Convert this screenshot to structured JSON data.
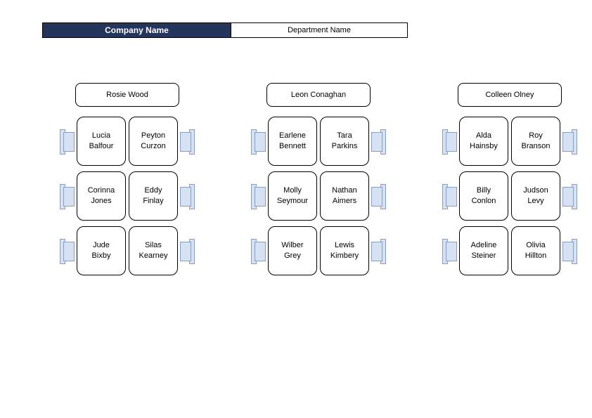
{
  "header": {
    "company": "Company Name",
    "department": "Department Name"
  },
  "groups": [
    {
      "head": "Rosie Wood",
      "rows": [
        {
          "left": "Lucia\nBalfour",
          "right": "Peyton\nCurzon"
        },
        {
          "left": "Corinna\nJones",
          "right": "Eddy\nFinlay"
        },
        {
          "left": "Jude\nBixby",
          "right": "Silas\nKearney"
        }
      ]
    },
    {
      "head": "Leon Conaghan",
      "rows": [
        {
          "left": "Earlene\nBennett",
          "right": "Tara\nParkins"
        },
        {
          "left": "Molly\nSeymour",
          "right": "Nathan\nAimers"
        },
        {
          "left": "Wilber\nGrey",
          "right": "Lewis\nKimbery"
        }
      ]
    },
    {
      "head": "Colleen Olney",
      "rows": [
        {
          "left": "Alda\nHainsby",
          "right": "Roy\nBranson"
        },
        {
          "left": "Billy\nConlon",
          "right": "Judson\nLevy"
        },
        {
          "left": "Adeline\nSteiner",
          "right": "Olivia\nHillton"
        }
      ]
    }
  ]
}
